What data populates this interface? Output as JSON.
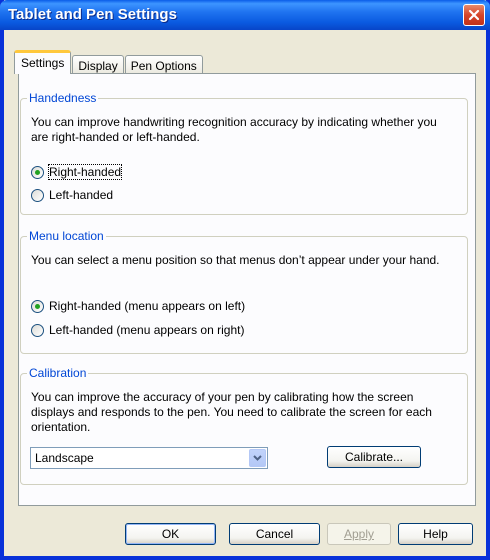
{
  "window": {
    "title": "Tablet and Pen Settings"
  },
  "tabs": [
    {
      "label": "Settings",
      "active": true
    },
    {
      "label": "Display",
      "active": false
    },
    {
      "label": "Pen Options",
      "active": false
    }
  ],
  "handedness": {
    "legend": "Handedness",
    "description": "You can improve handwriting recognition accuracy by indicating whether you are right-handed or left-handed.",
    "options": [
      {
        "label": "Right-handed",
        "selected": true
      },
      {
        "label": "Left-handed",
        "selected": false
      }
    ]
  },
  "menu_location": {
    "legend": "Menu location",
    "description": "You can select a menu position so that menus don’t appear under your hand.",
    "options": [
      {
        "label": "Right-handed (menu appears on left)",
        "selected": true
      },
      {
        "label": "Left-handed (menu appears on right)",
        "selected": false
      }
    ]
  },
  "calibration": {
    "legend": "Calibration",
    "description": "You can improve the accuracy of your pen by calibrating how the screen displays and responds to the pen. You need to calibrate the screen for each orientation.",
    "orientation_value": "Landscape",
    "calibrate_label": "Calibrate..."
  },
  "buttons": {
    "ok": "OK",
    "cancel": "Cancel",
    "apply": "Apply",
    "help": "Help"
  },
  "colors": {
    "title_bar": "#0a5ae0",
    "group_legend": "#0046d5",
    "radio_dot": "#21a121",
    "close_button": "#d6452a"
  }
}
